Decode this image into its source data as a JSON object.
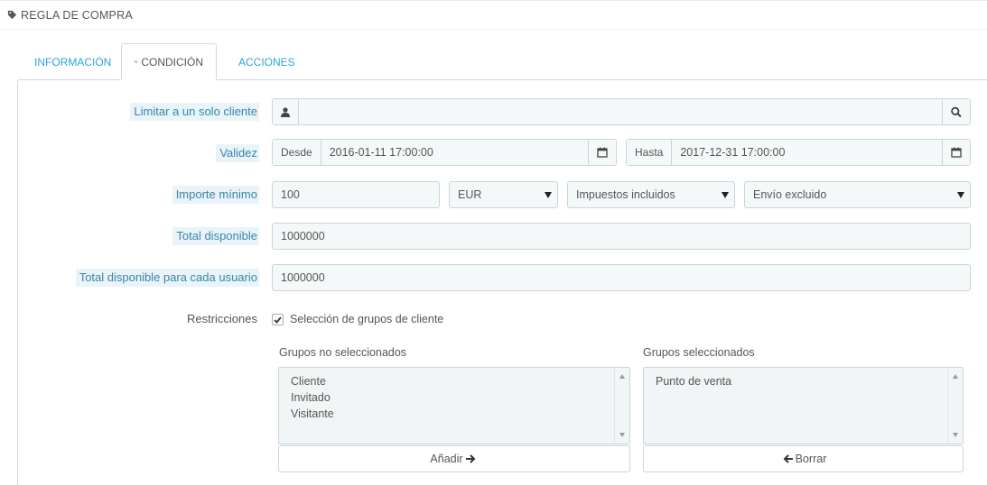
{
  "panel": {
    "title": "REGLA DE COMPRA",
    "icon": "tag-icon"
  },
  "tabs": [
    {
      "label": "INFORMACIÓN",
      "icon": "info-icon",
      "active": false
    },
    {
      "label": "CONDICIÓN",
      "icon": "shuffle-icon",
      "active": true
    },
    {
      "label": "ACCIONES",
      "icon": "wrench-icon",
      "active": false
    }
  ],
  "form": {
    "customer": {
      "label": "Limitar a un solo cliente",
      "value": "",
      "icons": [
        "user-icon",
        "search-icon"
      ]
    },
    "validity": {
      "label": "Validez",
      "from_label": "Desde",
      "from_value": "2016-01-11 17:00:00",
      "to_label": "Hasta",
      "to_value": "2017-12-31 17:00:00",
      "icon": "calendar-icon"
    },
    "minimum": {
      "label": "Importe mínimo",
      "amount": "100",
      "currency": "EUR",
      "tax": "Impuestos incluidos",
      "shipping": "Envío excluido"
    },
    "total": {
      "label": "Total disponible",
      "value": "1000000"
    },
    "total_per_user": {
      "label": "Total disponible para cada usuario",
      "value": "1000000"
    },
    "restrictions": {
      "label": "Restricciones",
      "checkbox_label": "Selección de grupos de cliente",
      "checked": true,
      "unselected_title": "Grupos no seleccionados",
      "unselected_items": [
        "Cliente",
        "Invitado",
        "Visitante"
      ],
      "selected_title": "Grupos seleccionados",
      "selected_items": [
        "Punto de venta"
      ],
      "add_button": "Añadir",
      "remove_button": "Borrar"
    }
  },
  "colors": {
    "link": "#2aa6d4",
    "label_text": "#3586ae",
    "label_bg": "#eaf3f8",
    "field_bg": "#f5f8f9"
  }
}
